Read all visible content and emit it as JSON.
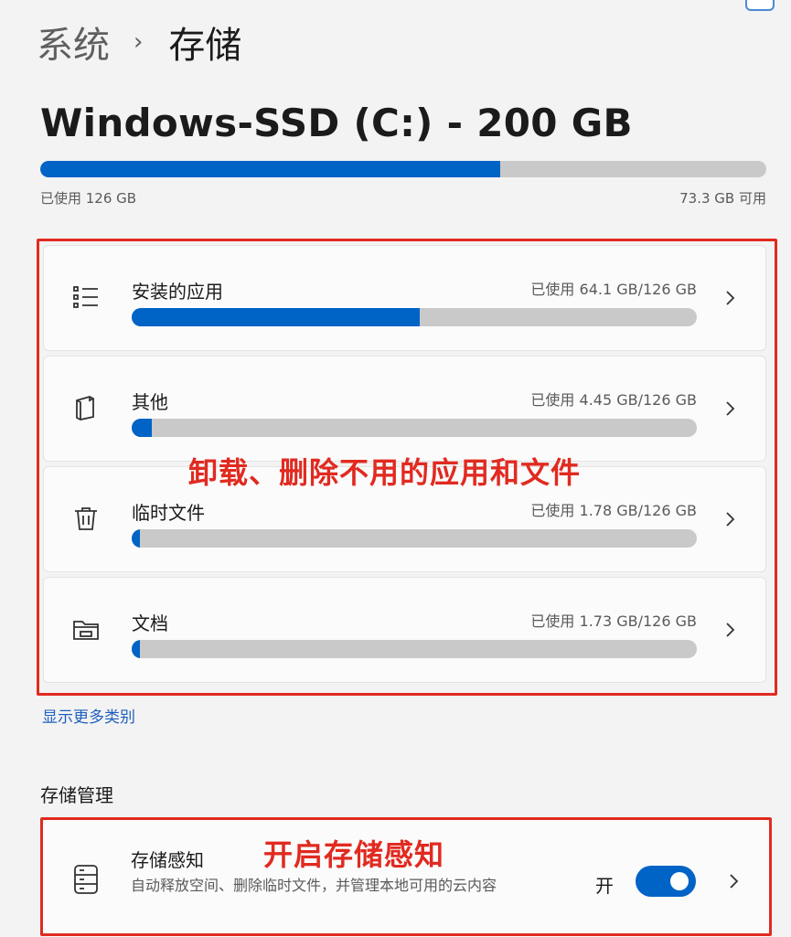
{
  "breadcrumb": {
    "parent": "系统",
    "separator": "›",
    "current": "存储"
  },
  "drive": {
    "title": "Windows-SSD (C:) - 200 GB",
    "used_label": "已使用 126 GB",
    "free_label": "73.3 GB 可用",
    "used_fraction": 0.634,
    "bar_color": "#0063c6"
  },
  "categories": [
    {
      "name": "安装的应用",
      "usage": "已使用 64.1 GB/126 GB",
      "fraction": 0.509,
      "icon": "list-icon"
    },
    {
      "name": "其他",
      "usage": "已使用 4.45 GB/126 GB",
      "fraction": 0.035,
      "icon": "document-icon"
    },
    {
      "name": "临时文件",
      "usage": "已使用 1.78 GB/126 GB",
      "fraction": 0.014,
      "icon": "trash-icon"
    },
    {
      "name": "文档",
      "usage": "已使用 1.73 GB/126 GB",
      "fraction": 0.014,
      "icon": "folder-icon"
    }
  ],
  "annotations": {
    "categories": "卸载、删除不用的应用和文件",
    "storage_sense": "开启存储感知"
  },
  "more_link": "显示更多类别",
  "management": {
    "section_title": "存储管理",
    "storage_sense": {
      "name": "存储感知",
      "description": "自动释放空间、删除临时文件，并管理本地可用的云内容",
      "state_label": "开",
      "toggle_on": true
    }
  },
  "colors": {
    "accent": "#0063c6",
    "annotation": "#e12a20",
    "link": "#1f5fbf"
  }
}
